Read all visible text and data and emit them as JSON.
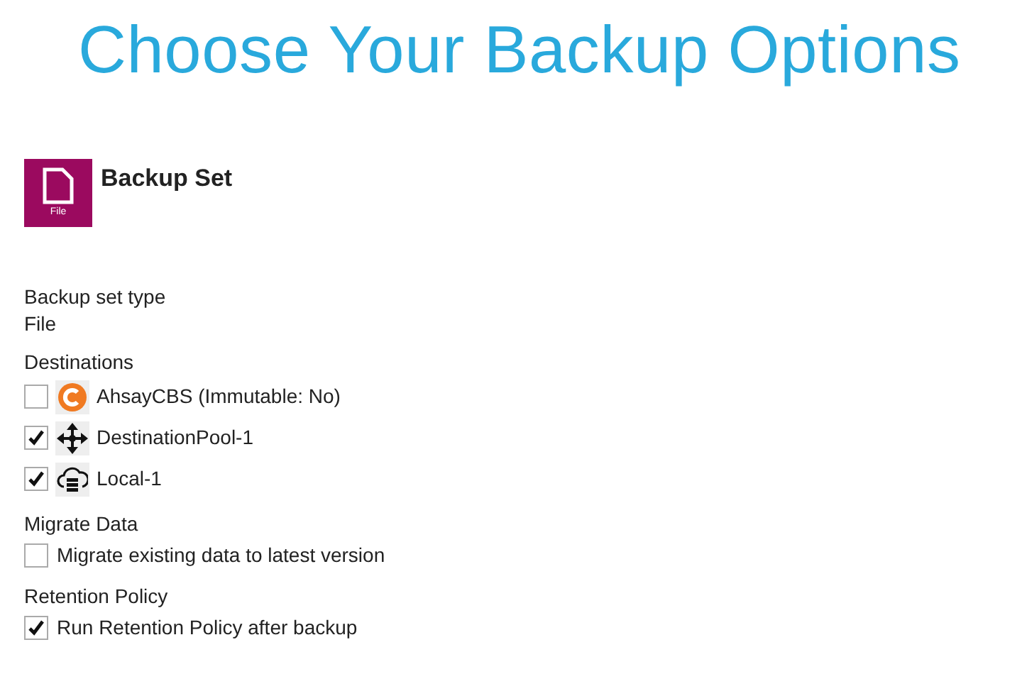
{
  "title": "Choose Your Backup Options",
  "backup_set": {
    "icon_label": "File",
    "heading": "Backup Set"
  },
  "backup_set_type": {
    "label": "Backup set type",
    "value": "File"
  },
  "destinations": {
    "label": "Destinations",
    "items": [
      {
        "name": "AhsayCBS (Immutable: No)",
        "kind": "cbs",
        "checked": false
      },
      {
        "name": "DestinationPool-1",
        "kind": "pool",
        "checked": true
      },
      {
        "name": "Local-1",
        "kind": "local",
        "checked": true
      }
    ]
  },
  "migrate_data": {
    "label": "Migrate Data",
    "option": "Migrate existing data to latest version",
    "checked": false
  },
  "retention_policy": {
    "label": "Retention Policy",
    "option": "Run Retention Policy after backup",
    "checked": true
  }
}
